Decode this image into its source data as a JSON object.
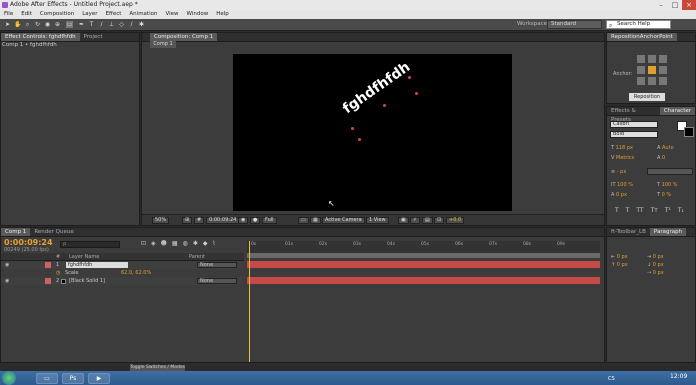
{
  "window": {
    "title": "Adobe After Effects - Untitled Project.aep *",
    "controls": [
      "–",
      "□",
      "×"
    ]
  },
  "menu": [
    "File",
    "Edit",
    "Composition",
    "Layer",
    "Effect",
    "Animation",
    "View",
    "Window",
    "Help"
  ],
  "toolbar": {
    "workspace_label": "Workspace:",
    "workspace_value": "Standard",
    "search_placeholder": "Search Help"
  },
  "left_panel": {
    "tabs": [
      "Effect Controls: fghdfhfdh",
      "Project"
    ],
    "subtitle": "Comp 1 • fghdfhfdh"
  },
  "composition": {
    "tab": "Composition: Comp 1",
    "subtab": "Comp 1",
    "text_layer": "fghdfhfdh",
    "controls": {
      "zoom": "50%",
      "timecode": "0:00:09:24",
      "resolution": "Full",
      "camera": "Active Camera",
      "views": "1 View",
      "exposure": "+0.0"
    }
  },
  "right_top": {
    "tab": "RepositionAnchorPoint",
    "anchor_label": "Anchor:",
    "button": "Reposition"
  },
  "right_mid": {
    "tabs": [
      "Effects & Presets",
      "Character"
    ],
    "font": "Calibri",
    "style": "Bold",
    "size": "118 px",
    "leading": "Auto",
    "kerning": "Metrics",
    "tracking": "0",
    "stroke": "- px",
    "vscale": "100 %",
    "hscale": "100 %",
    "baseline": "0 px",
    "tsume": "0 %"
  },
  "right_bot": {
    "tabs": [
      "ft-Toolbar_LB",
      "Paragraph"
    ],
    "indent_left": "0 px",
    "indent_right": "0 px",
    "indent_first": "0 px",
    "space_before": "0 px",
    "space_after": "0 px"
  },
  "timeline": {
    "tabs": [
      "Comp 1",
      "Render Queue"
    ],
    "timecode": "0:00:09:24",
    "timecode_sub": "00249 (25.00 fps)",
    "search_placeholder": "ρ",
    "header": {
      "num": "#",
      "name": "Layer Name",
      "parent": "Parent"
    },
    "layers": [
      {
        "num": "1",
        "name": "fghdfhfdh",
        "parent": "None"
      },
      {
        "num": "",
        "name": "Scale",
        "value": "62.0, 62.0%"
      },
      {
        "num": "2",
        "name": "[Black Solid 1]",
        "parent": "None"
      }
    ],
    "ruler_ticks": [
      "0s",
      "01s",
      "02s",
      "03s",
      "04s",
      "05s",
      "06s",
      "07s",
      "08s",
      "09s"
    ],
    "footer": "Toggle Switches / Modes"
  },
  "taskbar": {
    "time": "12:09",
    "lang": "CS"
  }
}
